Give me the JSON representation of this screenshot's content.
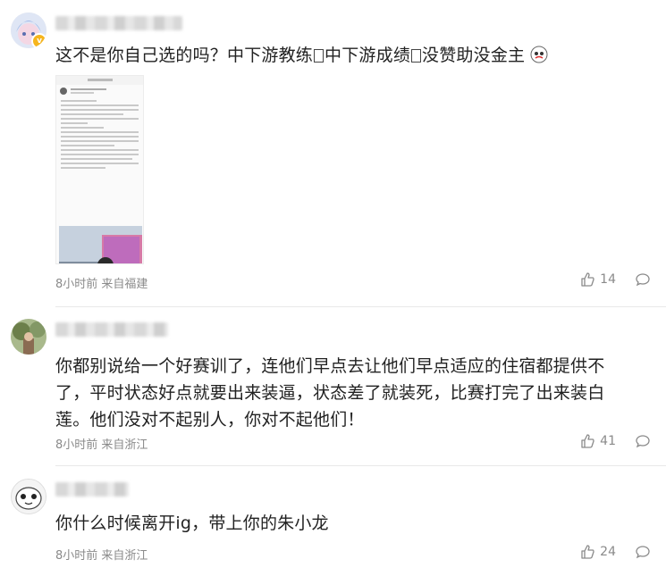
{
  "comments": [
    {
      "text_parts": [
        "这不是你自己选的吗？中下游教练",
        "中下游成绩",
        "没赞助没金主"
      ],
      "time": "8小时前",
      "location": "来自福建",
      "likes": "14",
      "has_badge": true
    },
    {
      "text": "你都别说给一个好赛训了，连他们早点去让他们早点适应的住宿都提供不了，平时状态好点就要出来装逼，状态差了就装死，比赛打完了出来装白莲。他们没对不起别人，你对不起他们！",
      "time": "8小时前",
      "location": "来自浙江",
      "likes": "41"
    },
    {
      "text": "你什么时候离开ig，带上你的朱小龙",
      "time": "8小时前",
      "location": "来自浙江",
      "likes": "24"
    }
  ],
  "colors": {
    "meta_text": "#8a8a8a",
    "badge": "#f6b51e",
    "divider": "#e9e9e9"
  },
  "icons": [
    "like-icon",
    "comment-icon",
    "verified-badge-icon",
    "sticker-emoji-icon"
  ]
}
